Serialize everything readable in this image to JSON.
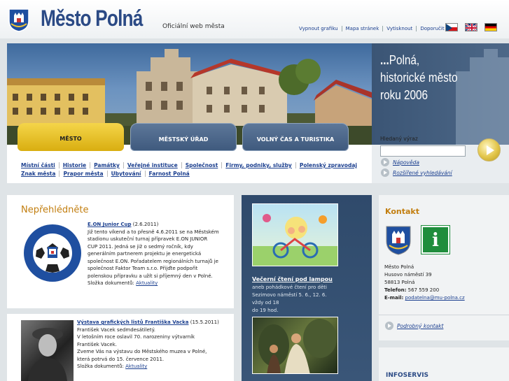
{
  "header": {
    "title": "Město Polná",
    "tagline": "Oficiální web města",
    "links": [
      "Vypnout grafiku",
      "Mapa stránek",
      "Vytisknout",
      "Doporučit"
    ],
    "flags": [
      "cz-flag-icon",
      "uk-flag-icon",
      "de-flag-icon"
    ]
  },
  "banner": {
    "slogan_l1_prefix": "...",
    "slogan_l1": "Polná,",
    "slogan_l2": "historické město",
    "slogan_l3": "roku 2006"
  },
  "tabs": [
    "MĚSTO",
    "MĚSTSKÝ ÚŘAD",
    "VOLNÝ ČAS A TURISTIKA"
  ],
  "subnav": {
    "row1": [
      "Místní části",
      "Historie",
      "Památky",
      "Veřejné instituce",
      "Společnost",
      "Firmy, podniky, služby",
      "Polenský zpravodaj"
    ],
    "row2": [
      "Znak města",
      "Prapor města",
      "Ubytování",
      "Farnost Polná"
    ]
  },
  "search": {
    "label": "Hledaný výraz",
    "value": "",
    "help": "Nápověda",
    "advanced": "Rozšířené vyhledávání"
  },
  "news": {
    "title": "Nepřehlédněte",
    "items": [
      {
        "headline": "E.ON Junior Cup",
        "date": "(2.6.2011)",
        "lines": [
          "Již tento víkend a to přesně 4.6.2011 se na Městském",
          "stadionu uskuteční turnaj přípravek E.ON JUNIOR",
          "CUP 2011. Jedná se již o sedmý ročník, kdy",
          "generálním partnerem projektu je energetická",
          "společnost E.ON. Pořadatelem regionálních turnajů je",
          "společnost Faktor Team s.r.o. Přijďte podpořit",
          "polenskou přípravku a užít si příjemný den v Polné."
        ],
        "docs_label": "Složka dokumentů:",
        "docs_link": "Aktuality"
      },
      {
        "headline": "Výstava grafických listů Františka Vacka",
        "date": "(15.5.2011)",
        "lines": [
          "František Vacek sedmdesátiletý.",
          "V letošním roce oslavil 70. narozeniny výtvarník",
          "František Vacek.",
          "Zveme Vás na výstavu do Městského muzea v Polné,",
          "která potrvá do 15. července 2011."
        ],
        "docs_label": "Složka dokumentů:",
        "docs_link": "Aktuality"
      }
    ],
    "logo_text_top": "SLAVOJ TKZ POLNÁ",
    "logo_text_bottom": "FOTBALOVÝ ODDÍL"
  },
  "feature": {
    "title": "Večerní čtení pod lampou",
    "lines": [
      "aneb pohádkové čtení pro děti",
      "Sezimovo náměstí 5. 6., 12. 6. vždy od 18",
      "do 19 hod."
    ]
  },
  "contact": {
    "title": "Kontakt",
    "name": "Město Polná",
    "street": "Husovo náměstí 39",
    "city": "58813 Polná",
    "phone_label": "Telefon:",
    "phone": "567 559 200",
    "email_label": "E-mail:",
    "email": "podatelna@mu-polna.cz",
    "more": "Podrobný kontakt"
  },
  "infoservis": {
    "title": "INFOSERVIS"
  }
}
